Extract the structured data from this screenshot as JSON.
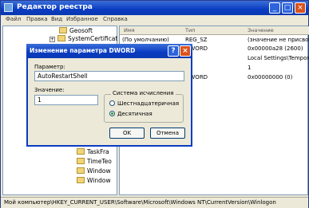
{
  "window": {
    "title": "Редактор реестра"
  },
  "menu": [
    "Файл",
    "Правка",
    "Вид",
    "Избранное",
    "Справка"
  ],
  "tree": [
    {
      "label": "Geosoft",
      "plus": false
    },
    {
      "label": "SystemCertificat",
      "plus": true
    },
    {
      "label": "TaskFra",
      "plus": false
    },
    {
      "label": "TimeTeo",
      "plus": false
    },
    {
      "label": "Window",
      "plus": false
    },
    {
      "label": "Window",
      "plus": false
    }
  ],
  "list": {
    "headers": [
      "Имя",
      "Тип",
      "Значение"
    ],
    "rows": [
      {
        "name": "(По умолчанию)",
        "type": "REG_SZ",
        "value": "(значение не присвоено)"
      },
      {
        "name": "",
        "type": "DWORD",
        "value": "0x00000a28 (2600)"
      },
      {
        "name": "",
        "type": "SZ",
        "value": "Local Settings\\Temporary"
      },
      {
        "name": "",
        "type": "SZ",
        "value": "1"
      },
      {
        "name": "",
        "type": "DWORD",
        "value": "0x00000000 (0)"
      }
    ]
  },
  "status": "Мой компьютер\\HKEY_CURRENT_USER\\Software\\Microsoft\\Windows NT\\CurrentVersion\\Winlogon",
  "dialog": {
    "title": "Изменение параметра DWORD",
    "param_label": "Параметр:",
    "param_value": "AutoRestartShell",
    "value_label": "Значение:",
    "value_value": "1",
    "base_label": "Система исчисления",
    "hex_label": "Шестнадцатеричная",
    "dec_label": "Десятичная",
    "ok_label": "OK",
    "cancel_label": "Отмена"
  }
}
